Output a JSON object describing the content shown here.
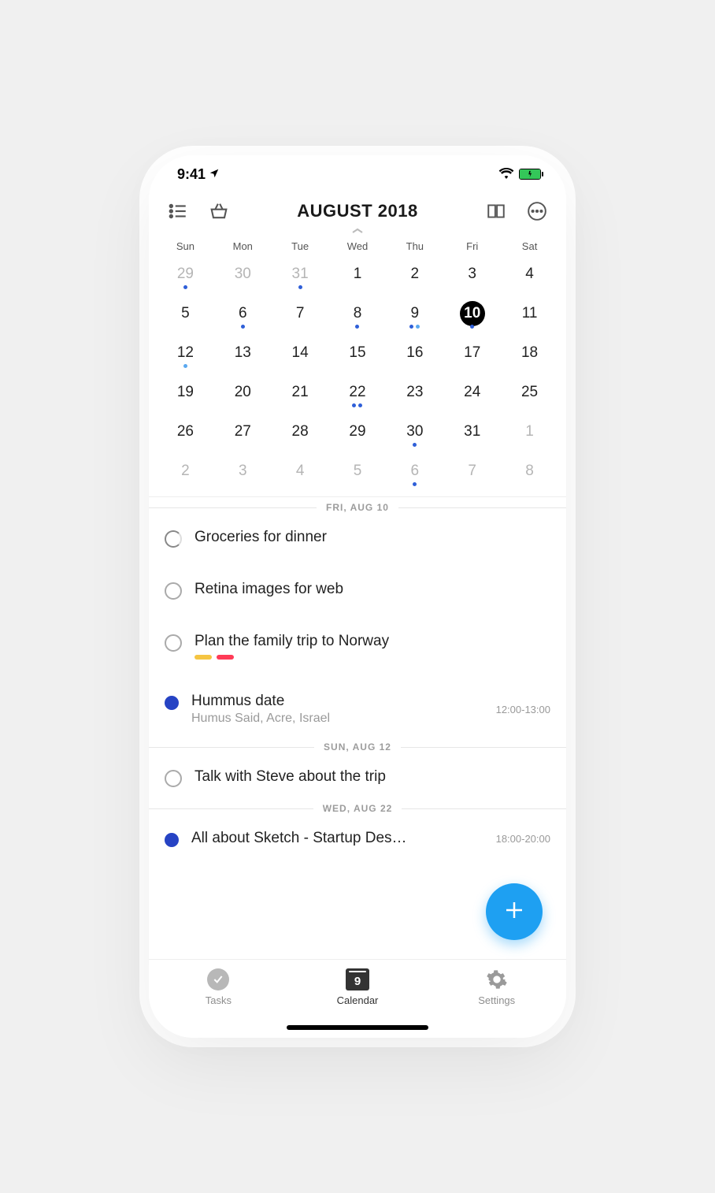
{
  "status": {
    "time": "9:41"
  },
  "header": {
    "month_title": "AUGUST 2018"
  },
  "weekdays": [
    "Sun",
    "Mon",
    "Tue",
    "Wed",
    "Thu",
    "Fri",
    "Sat"
  ],
  "grid": [
    {
      "n": "29",
      "outside": true,
      "dots": [
        "blue"
      ]
    },
    {
      "n": "30",
      "outside": true
    },
    {
      "n": "31",
      "outside": true,
      "dots": [
        "blue"
      ]
    },
    {
      "n": "1"
    },
    {
      "n": "2"
    },
    {
      "n": "3"
    },
    {
      "n": "4"
    },
    {
      "n": "5"
    },
    {
      "n": "6",
      "dots": [
        "blue"
      ]
    },
    {
      "n": "7"
    },
    {
      "n": "8",
      "dots": [
        "blue"
      ]
    },
    {
      "n": "9",
      "dots": [
        "blue",
        "light"
      ]
    },
    {
      "n": "10",
      "selected": true,
      "dots": [
        "blue"
      ]
    },
    {
      "n": "11"
    },
    {
      "n": "12",
      "dots": [
        "light"
      ]
    },
    {
      "n": "13"
    },
    {
      "n": "14"
    },
    {
      "n": "15"
    },
    {
      "n": "16"
    },
    {
      "n": "17"
    },
    {
      "n": "18"
    },
    {
      "n": "19"
    },
    {
      "n": "20"
    },
    {
      "n": "21"
    },
    {
      "n": "22",
      "dots": [
        "blue",
        "blue"
      ]
    },
    {
      "n": "23"
    },
    {
      "n": "24"
    },
    {
      "n": "25"
    },
    {
      "n": "26"
    },
    {
      "n": "27"
    },
    {
      "n": "28"
    },
    {
      "n": "29"
    },
    {
      "n": "30",
      "dots": [
        "blue"
      ]
    },
    {
      "n": "31"
    },
    {
      "n": "1",
      "outside": true
    },
    {
      "n": "2",
      "outside": true
    },
    {
      "n": "3",
      "outside": true
    },
    {
      "n": "4",
      "outside": true
    },
    {
      "n": "5",
      "outside": true
    },
    {
      "n": "6",
      "outside": true,
      "dots": [
        "blue"
      ]
    },
    {
      "n": "7",
      "outside": true
    },
    {
      "n": "8",
      "outside": true
    }
  ],
  "sections": [
    {
      "label": "FRI, AUG 10",
      "items": [
        {
          "type": "task",
          "title": "Groceries for dinner",
          "progress": "half"
        },
        {
          "type": "task",
          "title": "Retina images for web"
        },
        {
          "type": "task",
          "title": "Plan the family trip to Norway",
          "tags": [
            "yellow",
            "red"
          ]
        },
        {
          "type": "event",
          "title": "Hummus date",
          "subtitle": "Humus Said, Acre, Israel",
          "time": "12:00-13:00"
        }
      ]
    },
    {
      "label": "SUN, AUG 12",
      "items": [
        {
          "type": "task",
          "title": "Talk with Steve about the trip"
        }
      ]
    },
    {
      "label": "WED, AUG 22",
      "items": [
        {
          "type": "event",
          "title": "All about Sketch - Startup Des…",
          "time": "18:00-20:00"
        }
      ]
    }
  ],
  "tabs": {
    "tasks": "Tasks",
    "calendar": "Calendar",
    "calendar_day": "9",
    "settings": "Settings"
  }
}
